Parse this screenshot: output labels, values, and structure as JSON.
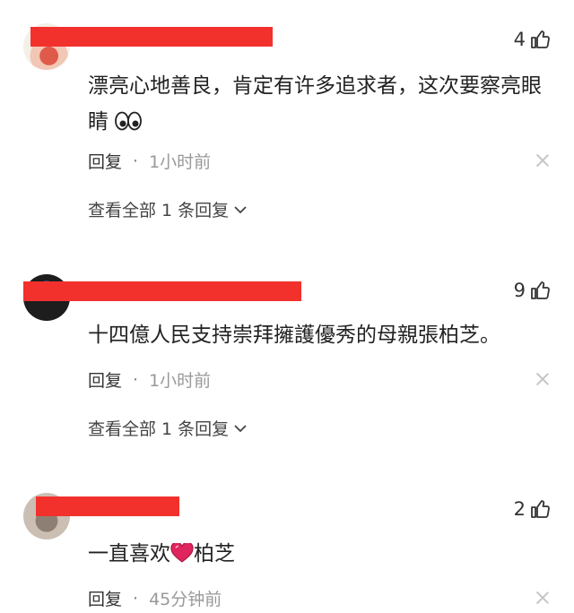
{
  "comments": [
    {
      "likes": "4",
      "text": "漂亮心地善良，肯定有许多追求者，这次要察亮眼睛",
      "emoji": "eyes-emoji",
      "reply_label": "回复",
      "time": "1小时前",
      "view_all": "查看全部 1 条回复"
    },
    {
      "likes": "9",
      "text": "十四億人民支持崇拜擁護優秀的母親張柏芝。",
      "reply_label": "回复",
      "time": "1小时前",
      "view_all": "查看全部 1 条回复"
    },
    {
      "likes": "2",
      "text_before": "一直喜欢",
      "emoji": "heart-emoji",
      "text_after": "柏芝",
      "reply_label": "回复",
      "time": "45分钟前"
    }
  ],
  "colors": {
    "redaction": "#f2312d",
    "text": "#222222",
    "meta": "#999999"
  }
}
